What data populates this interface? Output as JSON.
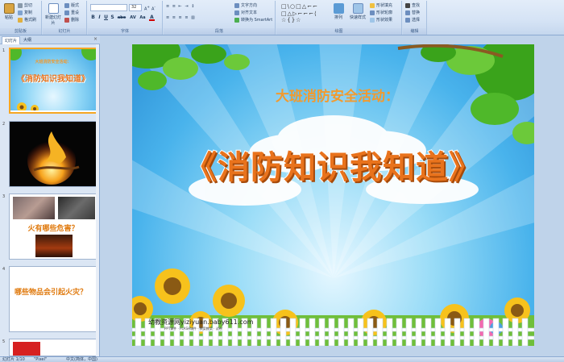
{
  "ribbon": {
    "clipboard": {
      "label": "剪贴板",
      "paste": "粘贴",
      "cut": "剪切",
      "copy": "复制",
      "format_painter": "格式刷"
    },
    "slides": {
      "label": "幻灯片",
      "new_slide": "新建幻灯片",
      "layout": "版式",
      "reset": "重设",
      "delete": "删除"
    },
    "font": {
      "label": "字体",
      "font_size": "32",
      "bold": "B",
      "italic": "I",
      "underline": "U",
      "shadow": "S",
      "strike": "abe",
      "spacing": "AV",
      "case": "Aa",
      "color": "A"
    },
    "paragraph": {
      "label": "段落",
      "text_direction": "文字方向",
      "align_text": "对齐文本",
      "smartart": "转换为 SmartArt"
    },
    "drawing": {
      "label": "绘图",
      "shapes": "□\\○□△⌐⌐\n□△⊳⌐⌐⌐⟨\n☆{}☆",
      "arrange": "排列",
      "quick_styles": "快速样式",
      "fill": "形状填充",
      "outline": "形状轮廓",
      "effects": "形状效果"
    },
    "editing": {
      "label": "编辑",
      "find": "查找",
      "replace": "替换",
      "select": "选择"
    }
  },
  "left_panel": {
    "tabs": [
      "幻灯片",
      "大纲"
    ],
    "close": "×",
    "thumbs": [
      {
        "num": "1",
        "title_small": "大班消防安全活动：",
        "title_big": "《消防知识我知道》"
      },
      {
        "num": "2"
      },
      {
        "num": "3",
        "text": "火有哪些危害？"
      },
      {
        "num": "4",
        "text": "哪些物品会引起火灾？"
      },
      {
        "num": "5"
      }
    ]
  },
  "slide": {
    "subtitle": "大班消防安全活动：",
    "title": "《消防知识我知道》",
    "footer": "幼教资源网yiziyuan.baby611.com",
    "footer_small": "PPT课件 · FLASH课件 · 教案教案 · 试卷"
  },
  "status": {
    "slide_count": "幻灯片 1/10",
    "theme": "\"Pixel\"",
    "language": "中文(简体，中国)"
  },
  "colors": {
    "ribbon": "#d5e3f5",
    "title_orange": "#e9731c",
    "subtitle_orange": "#f29a2e",
    "sky": "#49b3ec",
    "leaf": "#2f9a1c",
    "sunflower": "#f7c21c"
  }
}
